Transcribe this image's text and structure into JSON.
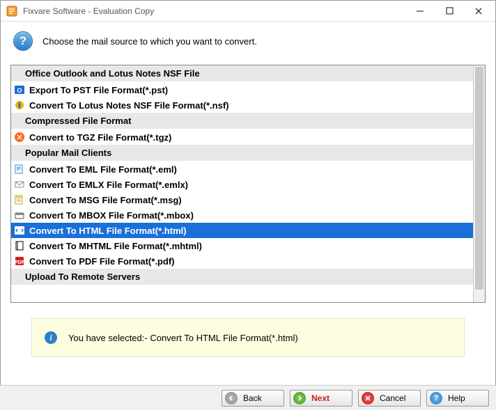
{
  "window": {
    "title": "Fixvare Software - Evaluation Copy"
  },
  "header": {
    "text": "Choose the mail source to which you want to convert."
  },
  "groups": [
    {
      "title": "Office Outlook and Lotus Notes NSF File",
      "items": [
        {
          "label": "Export To PST File Format(*.pst)",
          "icon": "outlook"
        },
        {
          "label": "Convert To Lotus Notes NSF File Format(*.nsf)",
          "icon": "lotus"
        }
      ]
    },
    {
      "title": "Compressed File Format",
      "items": [
        {
          "label": "Convert to TGZ File Format(*.tgz)",
          "icon": "tgz"
        }
      ]
    },
    {
      "title": "Popular Mail Clients",
      "items": [
        {
          "label": "Convert To EML File Format(*.eml)",
          "icon": "eml"
        },
        {
          "label": "Convert To EMLX File Format(*.emlx)",
          "icon": "emlx"
        },
        {
          "label": "Convert To MSG File Format(*.msg)",
          "icon": "msg"
        },
        {
          "label": "Convert To MBOX File Format(*.mbox)",
          "icon": "mbox"
        },
        {
          "label": "Convert To HTML File Format(*.html)",
          "icon": "html",
          "selected": true
        },
        {
          "label": "Convert To MHTML File Format(*.mhtml)",
          "icon": "mhtml"
        },
        {
          "label": "Convert To PDF File Format(*.pdf)",
          "icon": "pdf"
        }
      ]
    },
    {
      "title": "Upload To Remote Servers",
      "items": []
    }
  ],
  "info": {
    "prefix": "You have selected:- ",
    "selection": "Convert To HTML File Format(*.html)"
  },
  "buttons": {
    "back": "Back",
    "next": "Next",
    "cancel": "Cancel",
    "help": "Help"
  }
}
